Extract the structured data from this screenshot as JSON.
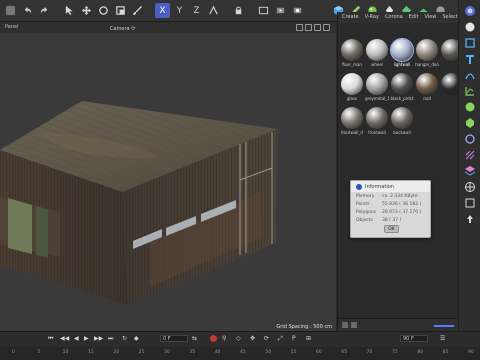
{
  "toolbar": {
    "icons": [
      "app-icon",
      "undo-icon",
      "redo-icon",
      "select-icon",
      "move-icon",
      "rotate-icon",
      "scale-icon",
      "brush-icon",
      "x-axis-icon",
      "y-axis-icon",
      "z-axis-icon",
      "world-icon",
      "lock-icon",
      "render-region-icon",
      "render-view-icon",
      "render-settings-icon",
      "cube-icon",
      "pen-icon",
      "sphere-icon",
      "light-icon",
      "camera-icon",
      "floor-icon",
      "effector-icon"
    ],
    "active_axis": "X",
    "axes": [
      "X",
      "Y",
      "Z"
    ]
  },
  "viewport": {
    "menu_label": "Panel",
    "camera_label": "Camera ⟳",
    "grid_spacing": "Grid Spacing : 500 cm"
  },
  "material_manager": {
    "menu": [
      "Create",
      "V-Ray",
      "Corona",
      "Edit",
      "View",
      "Select"
    ],
    "materials": [
      {
        "label": "floor_man",
        "color": "#6f6a61",
        "selected": false
      },
      {
        "label": "wheel",
        "color": "#bcbcbc",
        "selected": false
      },
      {
        "label": "lightwall",
        "color": "#a9b3c9",
        "selected": true
      },
      {
        "label": "hangar_doo",
        "color": "#8d857a",
        "selected": false
      },
      {
        "label": "",
        "color": "#585550",
        "selected": false
      },
      {
        "label": "glass",
        "color": "#d8d8d8",
        "selected": false
      },
      {
        "label": "greymetal_1",
        "color": "#a3a3a3",
        "selected": false
      },
      {
        "label": "black_prdct",
        "color": "#4d4d4d",
        "selected": false
      },
      {
        "label": "roof",
        "color": "#6e5b48",
        "selected": false
      },
      {
        "label": "",
        "color": "#2a2a2a",
        "selected": false
      },
      {
        "label": "frontwall_d",
        "color": "#7a746b",
        "selected": false
      },
      {
        "label": "frontwall",
        "color": "#6f6a65",
        "selected": false
      },
      {
        "label": "backwall",
        "color": "#6b6560",
        "selected": false
      }
    ]
  },
  "info_dialog": {
    "title": "Information",
    "rows": [
      {
        "key": "Memory",
        "value": "ca. 2 334 KByte"
      },
      {
        "key": "Points",
        "value": "55 836 ( 36 182 )"
      },
      {
        "key": "Polygons",
        "value": "28 973 ( 37 270 )"
      },
      {
        "key": "Objects",
        "value": "38 ( 37 )"
      }
    ],
    "ok_label": "OK"
  },
  "timeline": {
    "current_frame": "0",
    "frame_field": "0 F",
    "end_field": "90 F",
    "ticks": [
      "0",
      "5",
      "10",
      "15",
      "20",
      "25",
      "30",
      "35",
      "40",
      "45",
      "50",
      "55",
      "60",
      "65",
      "70",
      "75",
      "80",
      "85",
      "90"
    ]
  },
  "right_panel_icons": [
    "shading-icon",
    "sphere-preview-icon",
    "cube-icon",
    "text-icon",
    "path-icon",
    "graph-icon",
    "atom-icon",
    "settings-icon",
    "link-icon",
    "mesh-icon",
    "layers-icon",
    "globe-icon",
    "square-icon",
    "arrow-icon"
  ]
}
